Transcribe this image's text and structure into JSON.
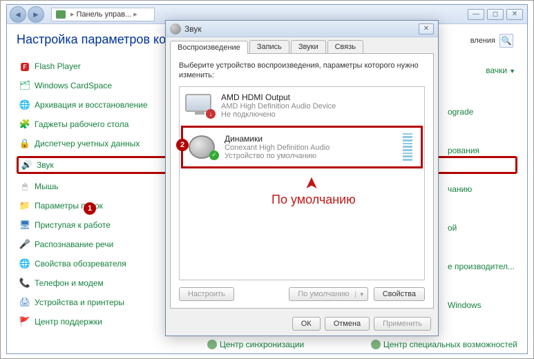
{
  "window": {
    "breadcrumb_label": "Панель управ...",
    "partial_right": "вления"
  },
  "cp": {
    "title": "Настройка параметров ком",
    "items": [
      {
        "label": "Flash Player",
        "icon": "🅵",
        "color": "#c22"
      },
      {
        "label": "Windows CardSpace",
        "icon": "🗂",
        "color": "#3a7"
      },
      {
        "label": "Архивация и восстановление",
        "icon": "🌐",
        "color": "#3a7"
      },
      {
        "label": "Гаджеты рабочего стола",
        "icon": "🧩",
        "color": "#37b"
      },
      {
        "label": "Диспетчер учетных данных",
        "icon": "🔒",
        "color": "#ca5"
      },
      {
        "label": "Звук",
        "icon": "🔊",
        "color": "#888",
        "highlighted": true
      },
      {
        "label": "Мышь",
        "icon": "🖱",
        "color": "#888"
      },
      {
        "label": "Параметры папок",
        "icon": "📁",
        "color": "#cb8"
      },
      {
        "label": "Приступая к работе",
        "icon": "🖥",
        "color": "#37b"
      },
      {
        "label": "Распознавание речи",
        "icon": "🎤",
        "color": "#37b"
      },
      {
        "label": "Свойства обозревателя",
        "icon": "🌐",
        "color": "#37b"
      },
      {
        "label": "Телефон и модем",
        "icon": "📞",
        "color": "#cb8"
      },
      {
        "label": "Устройства и принтеры",
        "icon": "🖨",
        "color": "#37b"
      },
      {
        "label": "Центр поддержки",
        "icon": "🚩",
        "color": "#37b"
      }
    ]
  },
  "right_links": {
    "top": "вачки",
    "items": [
      "ograde",
      "рования",
      "чанию",
      "ой",
      "е производител...",
      "Windows"
    ]
  },
  "bottom": {
    "left": "Центр синхронизации",
    "right": "Центр специальных возможностей"
  },
  "sound": {
    "title": "Звук",
    "tabs": [
      "Воспроизведение",
      "Запись",
      "Звуки",
      "Связь"
    ],
    "instruction": "Выберите устройство воспроизведения, параметры которого нужно изменить:",
    "devices": [
      {
        "name": "AMD HDMI Output",
        "sub1": "AMD High Definition Audio Device",
        "sub2": "Не подключено",
        "type": "monitor",
        "badge": "down"
      },
      {
        "name": "Динамики",
        "sub1": "Conexant High Definition Audio",
        "sub2": "Устройство по умолчанию",
        "type": "speaker",
        "badge": "ok",
        "highlighted": true
      }
    ],
    "buttons": {
      "configure": "Настроить",
      "default": "По умолчанию",
      "properties": "Свойства"
    },
    "footer": {
      "ok": "ОК",
      "cancel": "Отмена",
      "apply": "Применить"
    }
  },
  "annotations": {
    "num1": "1",
    "num2": "2",
    "default_label": "По умолчанию"
  }
}
